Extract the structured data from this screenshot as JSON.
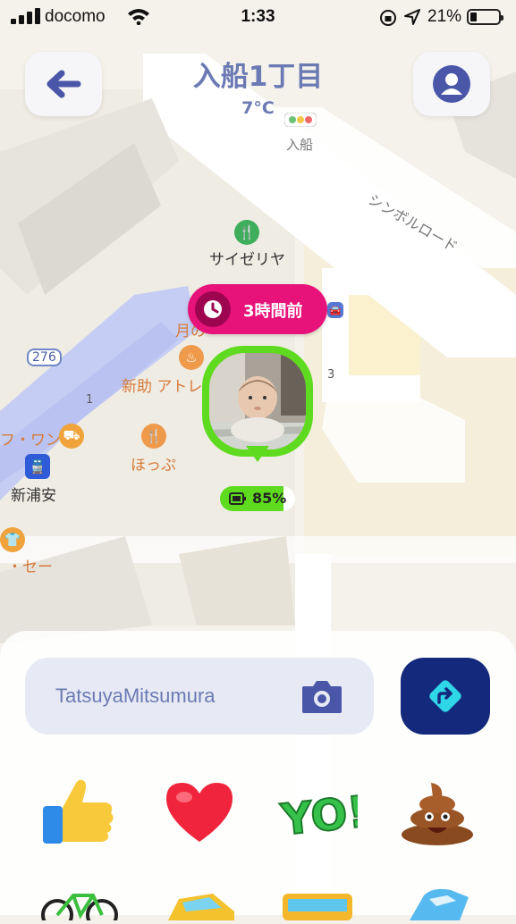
{
  "status_bar": {
    "carrier": "docomo",
    "time": "1:33",
    "battery_percent": "21%"
  },
  "header": {
    "title": "入船1丁目",
    "temperature": "7°C"
  },
  "map": {
    "labels": {
      "crossing": "入船",
      "road": "シンボルロード",
      "saizeriya": "サイゼリヤ",
      "route": "276",
      "shop_partial": "月の",
      "atre": "新助 アトレ",
      "one_a": "1",
      "three": "3",
      "wan": "フ・ワン",
      "hoppu": "ほっぷ",
      "station": "新浦安",
      "se": "・セー"
    }
  },
  "location_pin": {
    "elapsed": "3時間前",
    "battery": "85%",
    "battery_level": 0.85
  },
  "message_bar": {
    "recipient": "TatsuyaMitsumura"
  },
  "stamps": [
    {
      "icon": "thumbs-up-icon"
    },
    {
      "icon": "heart-icon"
    },
    {
      "icon": "yo-icon"
    },
    {
      "icon": "poop-icon"
    },
    {
      "icon": "bicycle-icon"
    },
    {
      "icon": "car-icon"
    },
    {
      "icon": "bus-icon"
    },
    {
      "icon": "train-icon"
    }
  ],
  "colors": {
    "accent": "#6c7ab4",
    "pin_green": "#5fdb1f",
    "time_pink": "#e8137a",
    "send_navy": "#14297c"
  }
}
